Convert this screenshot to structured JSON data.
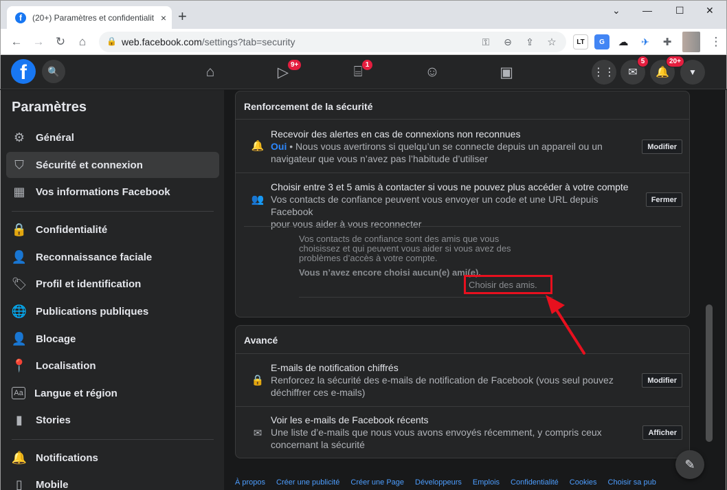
{
  "browser": {
    "tab_title": "(20+) Paramètres et confidentialit",
    "tab_close": "×",
    "new_tab": "+",
    "url_host": "web.facebook.com",
    "url_path": "/settings?tab=security",
    "ext_lt": "LT",
    "win_min": "—",
    "win_max": "☐",
    "win_close": "✕",
    "chevron": "⌄"
  },
  "topbar": {
    "logo": "f",
    "watch_badge": "9+",
    "marketplace_badge": "1",
    "messenger_badge": "5",
    "notifications_badge": "20+"
  },
  "sidebar": {
    "title": "Paramètres",
    "items": [
      {
        "label": "Général",
        "icon": "gear-icon"
      },
      {
        "label": "Sécurité et connexion",
        "icon": "shield-icon"
      },
      {
        "label": "Vos informations Facebook",
        "icon": "grid-icon"
      },
      {
        "label": "Confidentialité",
        "icon": "lock-icon"
      },
      {
        "label": "Reconnaissance faciale",
        "icon": "person-icon"
      },
      {
        "label": "Profil et identification",
        "icon": "tag-icon"
      },
      {
        "label": "Publications publiques",
        "icon": "globe-icon"
      },
      {
        "label": "Blocage",
        "icon": "block-user-icon"
      },
      {
        "label": "Localisation",
        "icon": "location-pin-icon"
      },
      {
        "label": "Langue et région",
        "icon": "language-icon"
      },
      {
        "label": "Stories",
        "icon": "stories-icon"
      },
      {
        "label": "Notifications",
        "icon": "bell-icon"
      },
      {
        "label": "Mobile",
        "icon": "mobile-icon"
      }
    ]
  },
  "security": {
    "heading": "Renforcement de la sécurité",
    "alerts": {
      "title": "Recevoir des alertes en cas de connexions non reconnues",
      "status": "Oui",
      "desc_line1": " • Nous vous avertirons si quelqu’un se connecte depuis un appareil ou un",
      "desc_line2": "navigateur que vous n’avez pas l’habitude d’utiliser",
      "button": "Modifier"
    },
    "trusted": {
      "title": "Choisir entre 3 et 5 amis à contacter si vous ne pouvez plus accéder à votre compte",
      "desc_line1": "Vos contacts de confiance peuvent vous envoyer un code et une URL depuis Facebook",
      "desc_line2": "pour vous aider à vous reconnecter",
      "button": "Fermer",
      "info_line1": "Vos contacts de confiance sont des amis que vous",
      "info_line2": "choisissez et qui peuvent vous aider si vous avez des",
      "info_line3": "problèmes d’accès à votre compte.",
      "none_chosen": "Vous n’avez encore choisi aucun(e) ami(e).",
      "choose_link": "Choisir des amis."
    }
  },
  "advanced": {
    "heading": "Avancé",
    "encrypted": {
      "title": "E-mails de notification chiffrés",
      "desc_line1": "Renforcez la sécurité des e-mails de notification de Facebook (vous seul pouvez",
      "desc_line2": "déchiffrer ces e-mails)",
      "button": "Modifier"
    },
    "recent": {
      "title": "Voir les e-mails de Facebook récents",
      "desc_line1": "Une liste d’e-mails que nous vous avons envoyés récemment, y compris ceux",
      "desc_line2": "concernant la sécurité",
      "button": "Afficher"
    }
  },
  "footer": {
    "links": [
      "À propos",
      "Créer une publicité",
      "Créer une Page",
      "Développeurs",
      "Emplois",
      "Confidentialité",
      "Cookies",
      "Choisir sa pub"
    ]
  }
}
